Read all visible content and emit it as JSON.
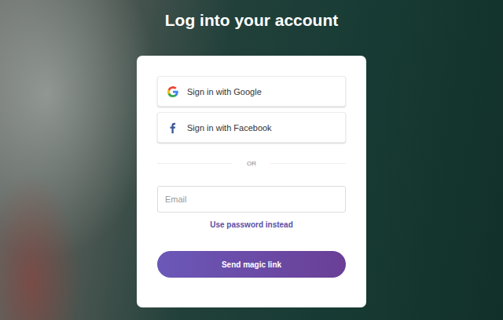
{
  "page": {
    "title": "Log into your account"
  },
  "social_buttons": [
    {
      "label": "Sign in with Google",
      "kind": "google"
    },
    {
      "label": "Sign in with Facebook",
      "kind": "facebook"
    }
  ],
  "divider": "OR",
  "email": {
    "placeholder": "Email"
  },
  "password_link": "Use password instead",
  "submit": "Send magic link"
}
